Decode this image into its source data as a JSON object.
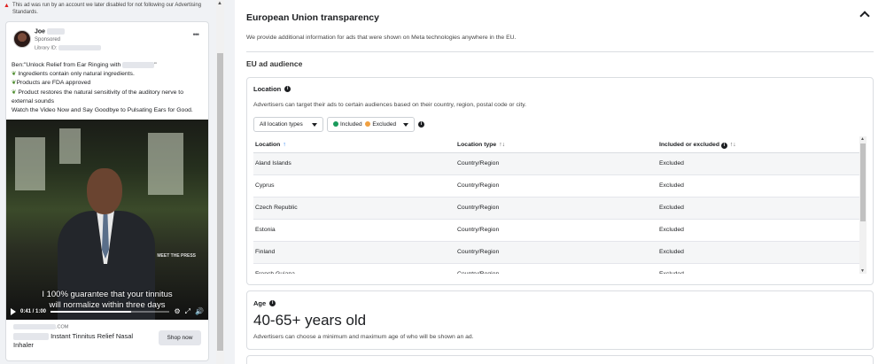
{
  "warning": {
    "text": "This ad was run by an account we later disabled for not following our Advertising Standards."
  },
  "ad": {
    "page_name": "Joe",
    "sponsored": "Sponsored",
    "library_id_label": "Library ID:",
    "more_label": "•••",
    "body_lines": [
      "Ben:\"Unlock Relief from Ear Ringing with",
      "Ingredients contain only natural ingredients.",
      "Products are FDA approved",
      "Product restores the natural sensitivity of the auditory nerve to external sounds",
      "Watch the Video Now and Say Goodbye to Pulsating Ears for Good."
    ],
    "body_suffix": "\"",
    "video": {
      "subtitle_line1": "I 100% guarantee that your tinnitus",
      "subtitle_line2": "will normalize within three days",
      "time": "0:41 / 1:00",
      "progress": 0.68,
      "watermark": "MEET THE PRESS"
    },
    "domain": ".COM",
    "title": "Instant Tinnitus Relief Nasal Inhaler",
    "cta": "Shop now"
  },
  "eu": {
    "title": "European Union transparency",
    "description": "We provide additional information for ads that were shown on Meta technologies anywhere in the EU.",
    "audience_title": "EU ad audience",
    "location": {
      "heading": "Location",
      "description": "Advertisers can target their ads to certain audiences based on their country, region, postal code or city.",
      "filter_types": "All location types",
      "filter_included": "Included",
      "filter_excluded": "Excluded",
      "columns": [
        "Location",
        "Location type",
        "Included or excluded"
      ],
      "rows": [
        [
          "Aland Islands",
          "Country/Region",
          "Excluded"
        ],
        [
          "Cyprus",
          "Country/Region",
          "Excluded"
        ],
        [
          "Czech Republic",
          "Country/Region",
          "Excluded"
        ],
        [
          "Estonia",
          "Country/Region",
          "Excluded"
        ],
        [
          "Finland",
          "Country/Region",
          "Excluded"
        ],
        [
          "French Guiana",
          "Country/Region",
          "Excluded"
        ]
      ]
    },
    "age": {
      "heading": "Age",
      "value": "40-65+ years old",
      "description": "Advertisers can choose a minimum and maximum age of who will be shown an ad."
    }
  },
  "colors": {
    "included_dot": "#1a9a5b",
    "excluded_dot": "#f0a040",
    "sort_active": "#1877f2"
  }
}
